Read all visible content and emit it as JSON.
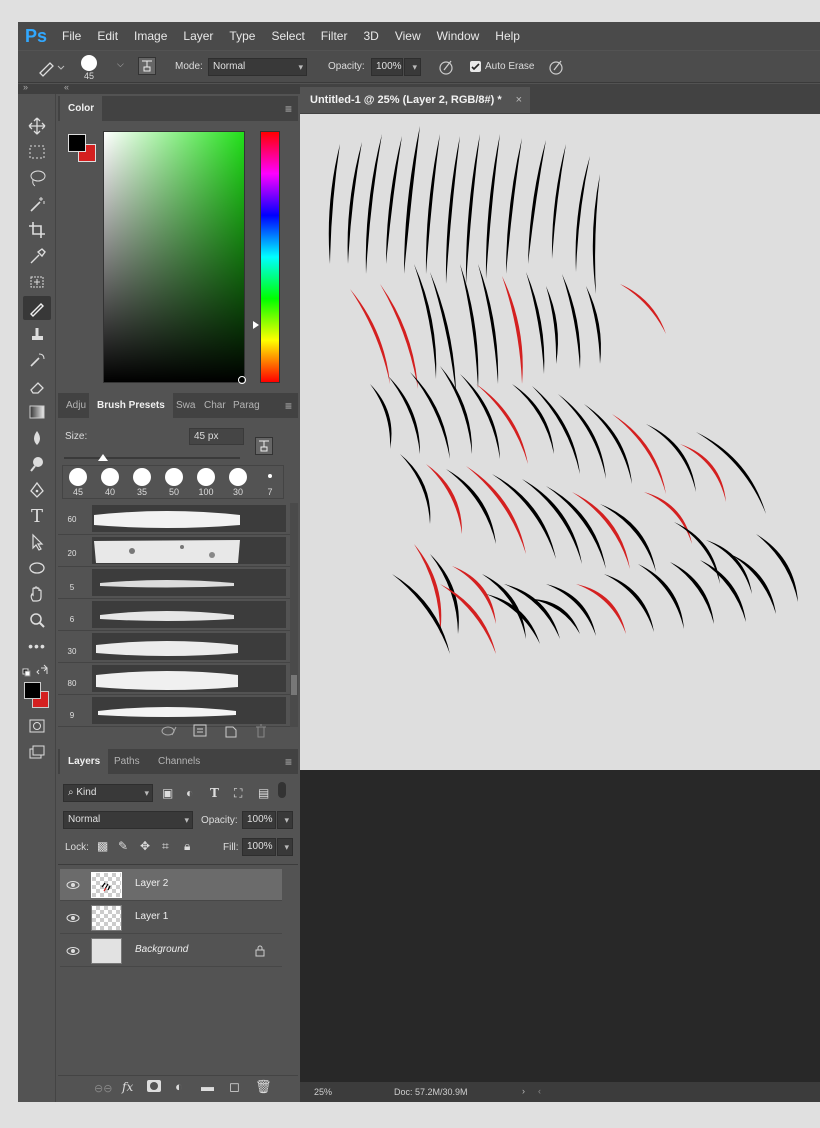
{
  "app": {
    "logo": "Ps"
  },
  "menu": [
    "File",
    "Edit",
    "Image",
    "Layer",
    "Type",
    "Select",
    "Filter",
    "3D",
    "View",
    "Window",
    "Help"
  ],
  "options": {
    "brush_size": "45",
    "mode_label": "Mode:",
    "mode_value": "Normal",
    "opacity_label": "Opacity:",
    "opacity_value": "100%",
    "auto_erase_label": "Auto Erase",
    "auto_erase_checked": true
  },
  "color_panel": {
    "tab": "Color",
    "foreground": "#000000",
    "background": "#d42020"
  },
  "brush_panel": {
    "tabs": [
      "Adju",
      "Brush Presets",
      "Swa",
      "Char",
      "Parag"
    ],
    "size_label": "Size:",
    "size_value": "45 px",
    "tips": [
      "45",
      "40",
      "35",
      "50",
      "100",
      "30",
      "7"
    ],
    "presets": [
      "60",
      "20",
      "5",
      "6",
      "30",
      "80",
      "9"
    ]
  },
  "layers_panel": {
    "tabs": [
      "Layers",
      "Paths",
      "Channels"
    ],
    "filter_label": "Kind",
    "blend_mode": "Normal",
    "opacity_label": "Opacity:",
    "opacity_value": "100%",
    "lock_label": "Lock:",
    "fill_label": "Fill:",
    "fill_value": "100%",
    "layers": [
      {
        "name": "Layer 2",
        "selected": true
      },
      {
        "name": "Layer 1",
        "selected": false
      },
      {
        "name": "Background",
        "selected": false,
        "locked": true
      }
    ]
  },
  "document": {
    "tab_title": "Untitled-1 @ 25% (Layer 2, RGB/8#) *",
    "zoom": "25%",
    "doc_size": "Doc: 57.2M/30.9M",
    "stroke_colors": {
      "black": "#000000",
      "red": "#d42020"
    }
  }
}
